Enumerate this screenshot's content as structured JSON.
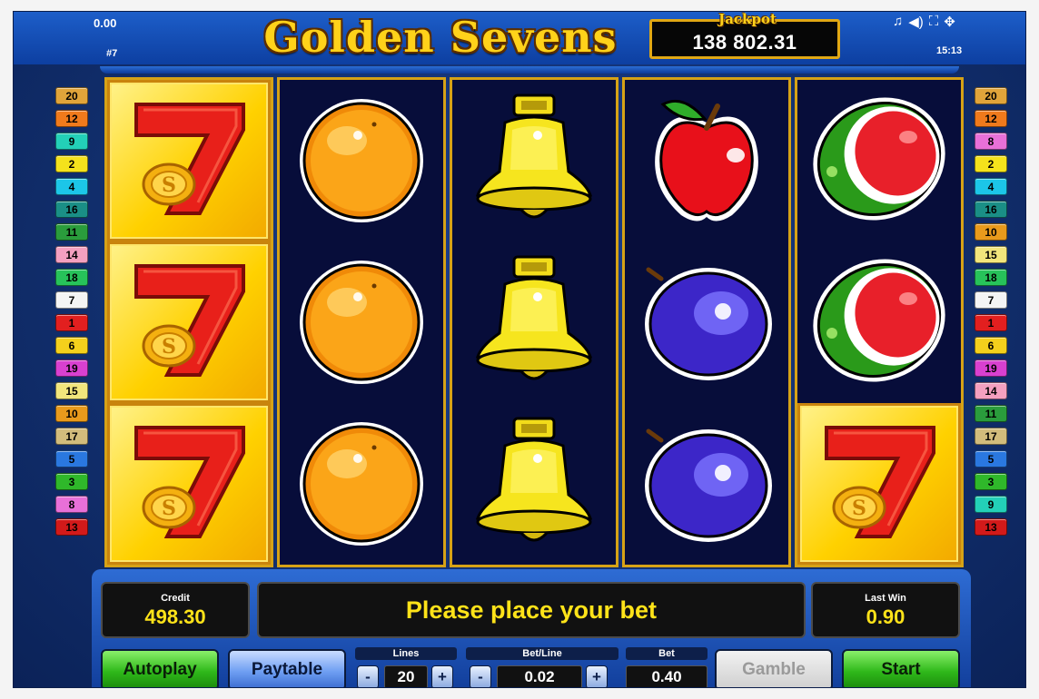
{
  "header": {
    "balance_top": "0.00",
    "game_number": "#7",
    "title": "Golden Sevens",
    "jackpot_label": "Jackpot",
    "jackpot_value": "138 802.31",
    "time": "15:13",
    "icons": [
      "music-icon",
      "speaker-icon",
      "fullscreen-icon",
      "settings-icon"
    ]
  },
  "lines_left": [
    {
      "n": "20",
      "color": "#e0a43a"
    },
    {
      "n": "12",
      "color": "#f07a1c"
    },
    {
      "n": "9",
      "color": "#23d0b8"
    },
    {
      "n": "2",
      "color": "#f4e21c"
    },
    {
      "n": "4",
      "color": "#1cc6e8"
    },
    {
      "n": "16",
      "color": "#1a8f86"
    },
    {
      "n": "11",
      "color": "#2a9c3c"
    },
    {
      "n": "14",
      "color": "#f4a0c0"
    },
    {
      "n": "18",
      "color": "#27c25a"
    },
    {
      "n": "7",
      "color": "#f4f4f4"
    },
    {
      "n": "1",
      "color": "#e21f1f"
    },
    {
      "n": "6",
      "color": "#f4d01c"
    },
    {
      "n": "19",
      "color": "#d940d0"
    },
    {
      "n": "15",
      "color": "#f2e67c"
    },
    {
      "n": "10",
      "color": "#e89a1c"
    },
    {
      "n": "17",
      "color": "#d2bc7c"
    },
    {
      "n": "5",
      "color": "#2a78e0"
    },
    {
      "n": "3",
      "color": "#2fb82a"
    },
    {
      "n": "8",
      "color": "#e870d8"
    },
    {
      "n": "13",
      "color": "#d21a1a"
    }
  ],
  "lines_right": [
    {
      "n": "20",
      "color": "#e0a43a"
    },
    {
      "n": "12",
      "color": "#f07a1c"
    },
    {
      "n": "8",
      "color": "#e870d8"
    },
    {
      "n": "2",
      "color": "#f4e21c"
    },
    {
      "n": "4",
      "color": "#1cc6e8"
    },
    {
      "n": "16",
      "color": "#1a8f86"
    },
    {
      "n": "10",
      "color": "#e89a1c"
    },
    {
      "n": "15",
      "color": "#f2e67c"
    },
    {
      "n": "18",
      "color": "#27c25a"
    },
    {
      "n": "7",
      "color": "#f4f4f4"
    },
    {
      "n": "1",
      "color": "#e21f1f"
    },
    {
      "n": "6",
      "color": "#f4d01c"
    },
    {
      "n": "19",
      "color": "#d940d0"
    },
    {
      "n": "14",
      "color": "#f4a0c0"
    },
    {
      "n": "11",
      "color": "#2a9c3c"
    },
    {
      "n": "17",
      "color": "#d2bc7c"
    },
    {
      "n": "5",
      "color": "#2a78e0"
    },
    {
      "n": "3",
      "color": "#2fb82a"
    },
    {
      "n": "9",
      "color": "#23d0b8"
    },
    {
      "n": "13",
      "color": "#d21a1a"
    }
  ],
  "reels": [
    [
      {
        "symbol": "seven",
        "win": true
      },
      {
        "symbol": "seven",
        "win": true
      },
      {
        "symbol": "seven",
        "win": true
      }
    ],
    [
      {
        "symbol": "orange",
        "win": false
      },
      {
        "symbol": "orange",
        "win": false
      },
      {
        "symbol": "orange",
        "win": false
      }
    ],
    [
      {
        "symbol": "bell",
        "win": false
      },
      {
        "symbol": "bell",
        "win": false
      },
      {
        "symbol": "bell",
        "win": false
      }
    ],
    [
      {
        "symbol": "apple",
        "win": false
      },
      {
        "symbol": "plum",
        "win": false
      },
      {
        "symbol": "plum",
        "win": false
      }
    ],
    [
      {
        "symbol": "watermelon",
        "win": false
      },
      {
        "symbol": "watermelon",
        "win": false
      },
      {
        "symbol": "seven",
        "win": true
      }
    ]
  ],
  "panel": {
    "credit_label": "Credit",
    "credit_value": "498.30",
    "message": "Please place your bet",
    "last_win_label": "Last Win",
    "last_win_value": "0.90",
    "autoplay_label": "Autoplay",
    "paytable_label": "Paytable",
    "lines_label": "Lines",
    "lines_value": "20",
    "bet_line_label": "Bet/Line",
    "bet_line_value": "0.02",
    "bet_label": "Bet",
    "bet_value": "0.40",
    "gamble_label": "Gamble",
    "start_label": "Start",
    "minus": "-",
    "plus": "+"
  }
}
